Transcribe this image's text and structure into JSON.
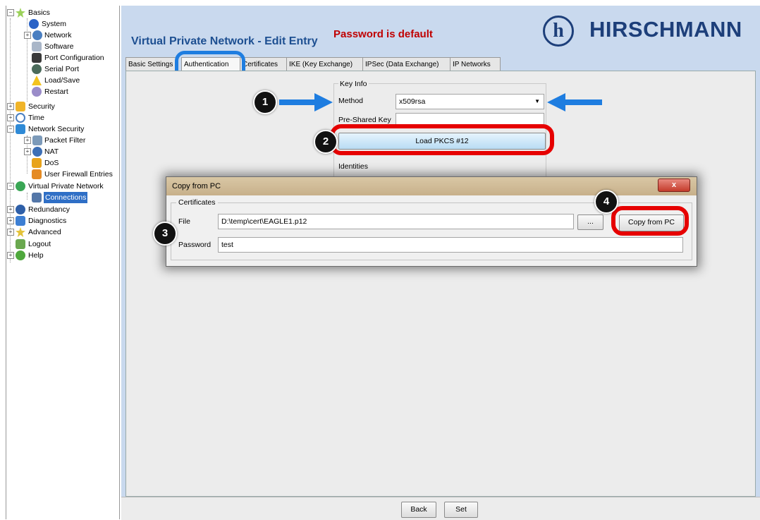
{
  "tree": {
    "items": [
      {
        "label": "Basics",
        "icon": "star-icon"
      },
      {
        "label": "System",
        "icon": "info-icon"
      },
      {
        "label": "Network",
        "icon": "network-icon"
      },
      {
        "label": "Software",
        "icon": "software-icon"
      },
      {
        "label": "Port Configuration",
        "icon": "port-icon"
      },
      {
        "label": "Serial Port",
        "icon": "serial-icon"
      },
      {
        "label": "Load/Save",
        "icon": "warning-icon"
      },
      {
        "label": "Restart",
        "icon": "restart-icon"
      },
      {
        "label": "Security",
        "icon": "lock-icon"
      },
      {
        "label": "Time",
        "icon": "clock-icon"
      },
      {
        "label": "Network Security",
        "icon": "shield-icon"
      },
      {
        "label": "Packet Filter",
        "icon": "filter-icon"
      },
      {
        "label": "NAT",
        "icon": "nat-icon"
      },
      {
        "label": "DoS",
        "icon": "dos-icon"
      },
      {
        "label": "User Firewall Entries",
        "icon": "firewall-icon"
      },
      {
        "label": "Virtual Private Network",
        "icon": "vpn-icon"
      },
      {
        "label": "Connections",
        "icon": "connections-icon"
      },
      {
        "label": "Redundancy",
        "icon": "redundancy-icon"
      },
      {
        "label": "Diagnostics",
        "icon": "diagnostics-icon"
      },
      {
        "label": "Advanced",
        "icon": "star-icon"
      },
      {
        "label": "Logout",
        "icon": "logout-icon"
      },
      {
        "label": "Help",
        "icon": "help-icon"
      }
    ]
  },
  "header": {
    "title": "Virtual Private Network - Edit Entry",
    "warning": "Password is default",
    "brand": "HIRSCHMANN",
    "brand_logo_letter": "h"
  },
  "tabs": [
    {
      "label": "Basic Settings"
    },
    {
      "label": "Authentication"
    },
    {
      "label": "Certificates"
    },
    {
      "label": "IKE (Key Exchange)"
    },
    {
      "label": "IPSec (Data Exchange)"
    },
    {
      "label": "IP Networks"
    }
  ],
  "keyinfo": {
    "legend": "Key Info",
    "method_label": "Method",
    "method_value": "x509rsa",
    "psk_label": "Pre-Shared Key",
    "load_button": "Load PKCS #12",
    "identities_label": "Identities"
  },
  "dialog": {
    "title": "Copy from PC",
    "close": "x",
    "group": "Certificates",
    "file_label": "File",
    "file_value": "D:\\temp\\cert\\EAGLE1.p12",
    "browse": "...",
    "copy_button": "Copy from PC",
    "password_label": "Password",
    "password_value": "test"
  },
  "footer": {
    "back": "Back",
    "set": "Set"
  },
  "annotations": {
    "badge1": "1",
    "badge2": "2",
    "badge3": "3",
    "badge4": "4"
  },
  "colors": {
    "header_bg": "#c9d9ee",
    "title_blue": "#1d4f91",
    "warning_red": "#c00000",
    "highlight_red": "#e60000",
    "arrow_blue": "#1e7de0"
  }
}
